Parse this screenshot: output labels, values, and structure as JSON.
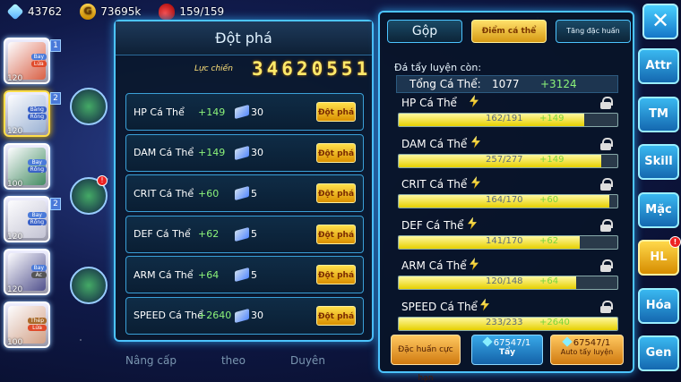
{
  "topbar": {
    "gems": "43762",
    "gold": "73695k",
    "gold_icon_letter": "G",
    "energy": "159/159"
  },
  "roster": [
    {
      "level": "120",
      "tags": [
        "Bay",
        "Lửa"
      ],
      "num": "1",
      "color": "#e05a3a"
    },
    {
      "level": "120",
      "tags": [
        "Băng",
        "Rồng"
      ],
      "num": "2",
      "color": "#9ab4d8"
    },
    {
      "level": "100",
      "tags": [
        "Bay",
        "Rồng"
      ],
      "num": "",
      "color": "#3a8a5a"
    },
    {
      "level": "120",
      "tags": [
        "Bay",
        "Rồng"
      ],
      "num": "2",
      "color": "#c8c8d8"
    },
    {
      "level": "120",
      "tags": [
        "Bay",
        "Ác"
      ],
      "num": "",
      "color": "#4a4a8a"
    },
    {
      "level": "100",
      "tags": [
        "Thép",
        "Lửa"
      ],
      "num": "",
      "color": "#d8a080"
    }
  ],
  "popup": {
    "title": "Đột phá",
    "power_label": "Lực chiến",
    "power_value": "34620551",
    "rows": [
      {
        "name": "HP Cá Thể",
        "inc": "+149",
        "cost": "30",
        "btn": "Đột phá"
      },
      {
        "name": "DAM Cá Thể",
        "inc": "+149",
        "cost": "30",
        "btn": "Đột phá"
      },
      {
        "name": "CRIT Cá Thể",
        "inc": "+60",
        "cost": "5",
        "btn": "Đột phá"
      },
      {
        "name": "DEF Cá Thể",
        "inc": "+62",
        "cost": "5",
        "btn": "Đột phá"
      },
      {
        "name": "ARM Cá Thể",
        "inc": "+64",
        "cost": "5",
        "btn": "Đột phá"
      },
      {
        "name": "SPEED Cá Thể",
        "inc": "+2640",
        "cost": "30",
        "btn": "Đột phá"
      }
    ]
  },
  "panel": {
    "tabs": [
      "Gộp",
      "Điểm cá thể",
      "Tăng đặc huấn"
    ],
    "available_label": "Đá tẩy luyện còn:",
    "total_label": "Tổng Cá Thể:",
    "total_value": "1077",
    "total_bonus": "+3124",
    "stats": [
      {
        "name": "HP Cá Thể",
        "value": "162/191",
        "bonus": "+149",
        "fill": 0.848
      },
      {
        "name": "DAM Cá Thể",
        "value": "257/277",
        "bonus": "+149",
        "fill": 0.928
      },
      {
        "name": "CRIT Cá Thể",
        "value": "164/170",
        "bonus": "+60",
        "fill": 0.965
      },
      {
        "name": "DEF Cá Thể",
        "value": "141/170",
        "bonus": "+62",
        "fill": 0.829
      },
      {
        "name": "ARM Cá Thể",
        "value": "120/148",
        "bonus": "+64",
        "fill": 0.811
      },
      {
        "name": "SPEED Cá Thể",
        "value": "233/233",
        "bonus": "+2640",
        "fill": 1.0
      }
    ],
    "btn_special": "Đặc huấn cực hạn",
    "btn_wash_count": "67547/1",
    "btn_wash_label": "Tẩy",
    "btn_auto_count": "67547/1",
    "btn_auto_label": "Auto tẩy luyện"
  },
  "nav": {
    "close": "✕",
    "items": [
      "Attr",
      "TM",
      "Skill",
      "Mặc",
      "HL",
      "Hóa",
      "Gen"
    ],
    "active": "HL",
    "alert": "!"
  },
  "faded": [
    "Nâng cấp",
    "theo",
    "Duyên"
  ],
  "colors": {
    "accent": "#4cc4ff",
    "gold": "#ffd34d",
    "green": "#8cf37a"
  }
}
